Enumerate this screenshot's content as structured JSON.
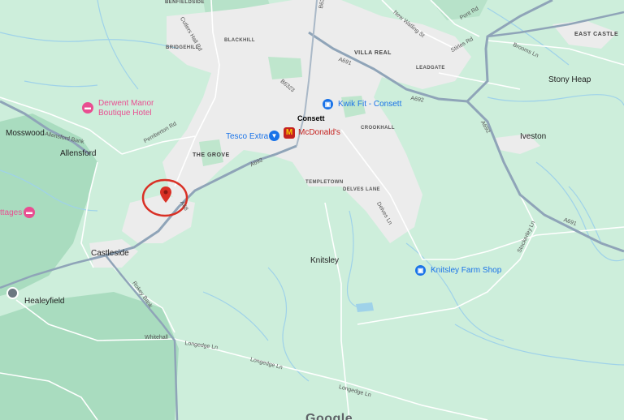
{
  "map": {
    "towns": {
      "consett": "Consett",
      "mosswood": "Mosswood",
      "allensford": "Allensford",
      "castleside": "Castleside",
      "healeyfield": "Healeyfield",
      "knitsley": "Knitsley",
      "stony_heap": "Stony Heap",
      "iveston": "Iveston"
    },
    "areas": {
      "benfieldside": "BENFIELDSIDE",
      "blackhill": "BLACKHILL",
      "bridgehill": "BRIDGEHILL",
      "villa_real": "VILLA REAL",
      "leadgate": "LEADGATE",
      "east_castle": "EAST CASTLE",
      "crookhall": "CROOKHALL",
      "the_grove": "THE GROVE",
      "templetown": "TEMPLETOWN",
      "delves_lane": "DELVES LANE"
    },
    "roads": {
      "cutlers_hall": "Cutlers Hall Rd",
      "b6308": "B6308",
      "b6323": "B6323",
      "new_watling": "New Watling St",
      "pont_rd": "Pont Rd",
      "stirles_rd": "Stirles Rd",
      "brooms_ln": "Brooms Ln",
      "a691_top": "A691",
      "a692_consett": "A692",
      "a692_right": "A692",
      "a691_right": "A691",
      "allensford_bank": "Allensford Bank",
      "pemberton_rd": "Pemberton Rd",
      "a68": "A68",
      "delves_ln": "Delves Ln",
      "stockerley_ln": "Stockerley Ln",
      "rokey_bank": "Rokey Bank",
      "whitehall": "Whitehall",
      "longedge_ln_1": "Longedge Ln",
      "longedge_ln_2": "Longedge Ln",
      "longedge_ln_3": "Longedge Ln",
      "a692_mid": "A692"
    },
    "pois": {
      "kwikfit": "Kwik Fit - Consett",
      "tesco": "Tesco Extra",
      "mcdonalds": "McDonald's",
      "derwent_manor": "Derwent Manor\nBoutique Hotel",
      "cottages": "ttages",
      "knitsley_farm": "Knitsley Farm Shop"
    },
    "attribution": "Google",
    "colors": {
      "land": "#cdeedb",
      "forest": "#a8dcbe",
      "urban": "#ececec",
      "road": "#ffffff",
      "major_road": "#8fa4b8",
      "water": "#9fd2e9",
      "marker": "#d93025",
      "poi_blue": "#1a73e8",
      "poi_pink": "#e94e91"
    },
    "icons": {
      "kwikfit": "shopping-bag-icon",
      "tesco": "shopping-cart-icon",
      "mcdonalds": "mcdonalds-icon",
      "hotel": "hotel-bed-icon",
      "farm_shop": "shopping-bag-icon",
      "healeyfield": "place-icon",
      "marker": "location-pin-icon"
    }
  }
}
